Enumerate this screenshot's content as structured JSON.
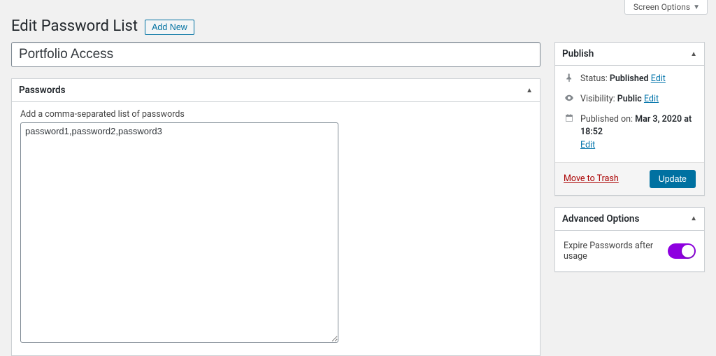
{
  "screen_options_label": "Screen Options",
  "page_title": "Edit Password List",
  "add_new_label": "Add New",
  "title_value": "Portfolio Access",
  "passwords_box": {
    "title": "Passwords",
    "field_label": "Add a comma-separated list of passwords",
    "value": "password1,password2,password3"
  },
  "publish": {
    "title": "Publish",
    "status_label": "Status:",
    "status_value": "Published",
    "edit_label": "Edit",
    "visibility_label": "Visibility:",
    "visibility_value": "Public",
    "published_on_label": "Published on:",
    "published_on_value": "Mar 3, 2020 at 18:52",
    "trash_label": "Move to Trash",
    "update_label": "Update"
  },
  "advanced": {
    "title": "Advanced Options",
    "expire_label": "Expire Passwords after usage",
    "expire_enabled": true
  }
}
